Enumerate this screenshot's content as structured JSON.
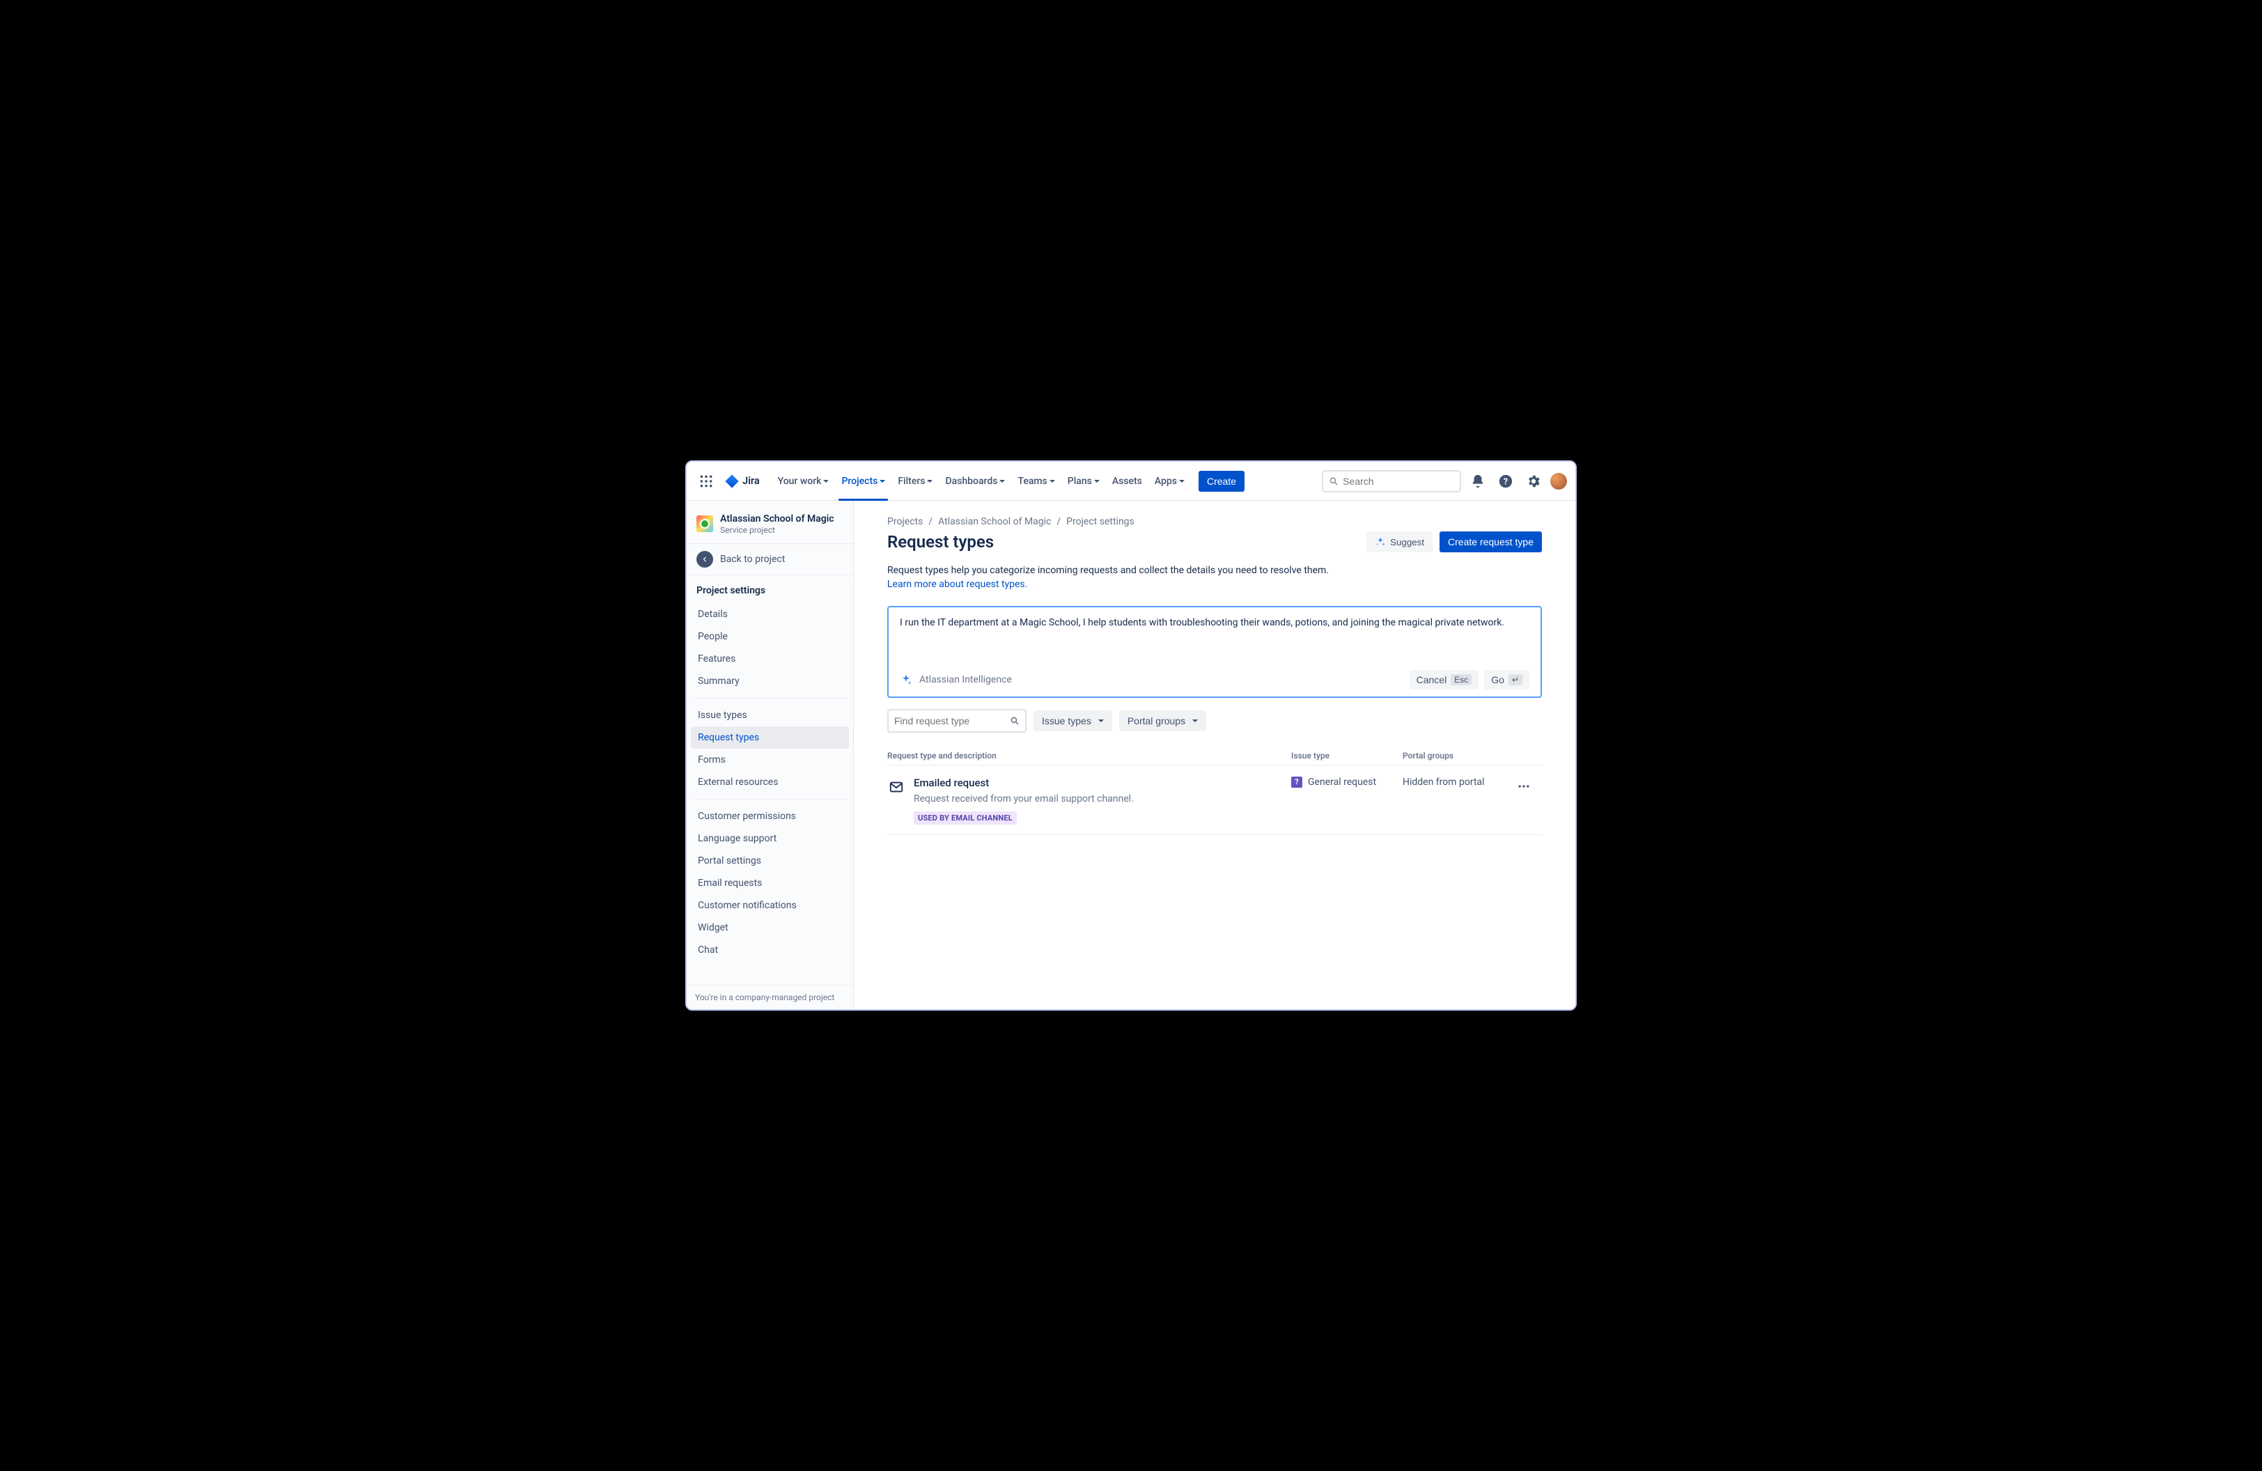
{
  "app": {
    "name": "Jira"
  },
  "topnav": {
    "items": [
      {
        "label": "Your work",
        "hasChevron": true
      },
      {
        "label": "Projects",
        "hasChevron": true,
        "active": true
      },
      {
        "label": "Filters",
        "hasChevron": true
      },
      {
        "label": "Dashboards",
        "hasChevron": true
      },
      {
        "label": "Teams",
        "hasChevron": true
      },
      {
        "label": "Plans",
        "hasChevron": true
      },
      {
        "label": "Assets",
        "hasChevron": false
      },
      {
        "label": "Apps",
        "hasChevron": true
      }
    ],
    "create_label": "Create",
    "search_placeholder": "Search"
  },
  "sidebar": {
    "project_name": "Atlassian School of Magic",
    "project_type": "Service project",
    "back_label": "Back to project",
    "heading": "Project settings",
    "groups": [
      [
        {
          "label": "Details"
        },
        {
          "label": "People"
        },
        {
          "label": "Features"
        },
        {
          "label": "Summary"
        }
      ],
      [
        {
          "label": "Issue types"
        },
        {
          "label": "Request types",
          "active": true
        },
        {
          "label": "Forms"
        },
        {
          "label": "External resources"
        }
      ],
      [
        {
          "label": "Customer permissions"
        },
        {
          "label": "Language support"
        },
        {
          "label": "Portal settings"
        },
        {
          "label": "Email requests"
        },
        {
          "label": "Customer notifications"
        },
        {
          "label": "Widget"
        },
        {
          "label": "Chat"
        }
      ]
    ],
    "footer": "You're in a company-managed project"
  },
  "breadcrumb": {
    "items": [
      "Projects",
      "Atlassian School of Magic",
      "Project settings"
    ]
  },
  "page": {
    "title": "Request types",
    "suggest_label": "Suggest",
    "create_label": "Create request type",
    "description": "Request types help you categorize incoming requests and collect the details you need to resolve them.",
    "learn_more": "Learn more about request types."
  },
  "ai_box": {
    "text": "I run the IT department at a Magic School, I help students with troubleshooting their wands, potions, and joining the magical private network.",
    "brand": "Atlassian Intelligence",
    "cancel_label": "Cancel",
    "cancel_key": "Esc",
    "go_label": "Go",
    "go_key": "↵"
  },
  "filters": {
    "search_placeholder": "Find request type",
    "issue_types_label": "Issue types",
    "portal_groups_label": "Portal groups"
  },
  "table": {
    "columns": {
      "desc": "Request type and description",
      "issue": "Issue type",
      "portal": "Portal groups"
    },
    "rows": [
      {
        "title": "Emailed request",
        "description": "Request received from your email support channel.",
        "badge": "USED BY EMAIL CHANNEL",
        "issue_type": "General request",
        "portal": "Hidden from portal"
      }
    ]
  }
}
